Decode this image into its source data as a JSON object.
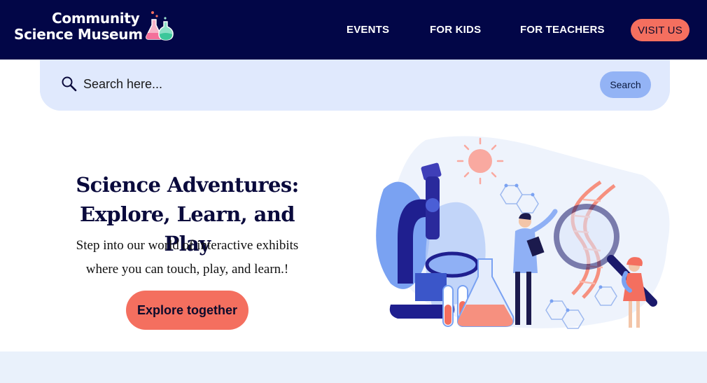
{
  "header": {
    "logo_line1": "Community",
    "logo_line2": "Science Museum",
    "logo_icon": "flasks-icon",
    "nav": [
      {
        "label": "EVENTS"
      },
      {
        "label": "FOR KIDS"
      },
      {
        "label": "FOR TEACHERS"
      }
    ],
    "visit_label": "VISIT US"
  },
  "search": {
    "placeholder": "Search here...",
    "button_label": "Search",
    "icon": "magnifier-icon"
  },
  "hero": {
    "title_line1": "Science Adventures:",
    "title_line2": "Explore, Learn, and Play",
    "text_line1": "Step into our world of interactive exhibits",
    "text_line2": "where you can touch, play, and learn.!",
    "cta_label": "Explore together",
    "illustration": "scientists-microscope-dna-illustration"
  },
  "colors": {
    "header_bg": "#020647",
    "accent": "#f46f5f",
    "search_bg": "#e0e9fd",
    "search_button": "#93b3f5",
    "bottom_band": "#e9f1fb"
  }
}
